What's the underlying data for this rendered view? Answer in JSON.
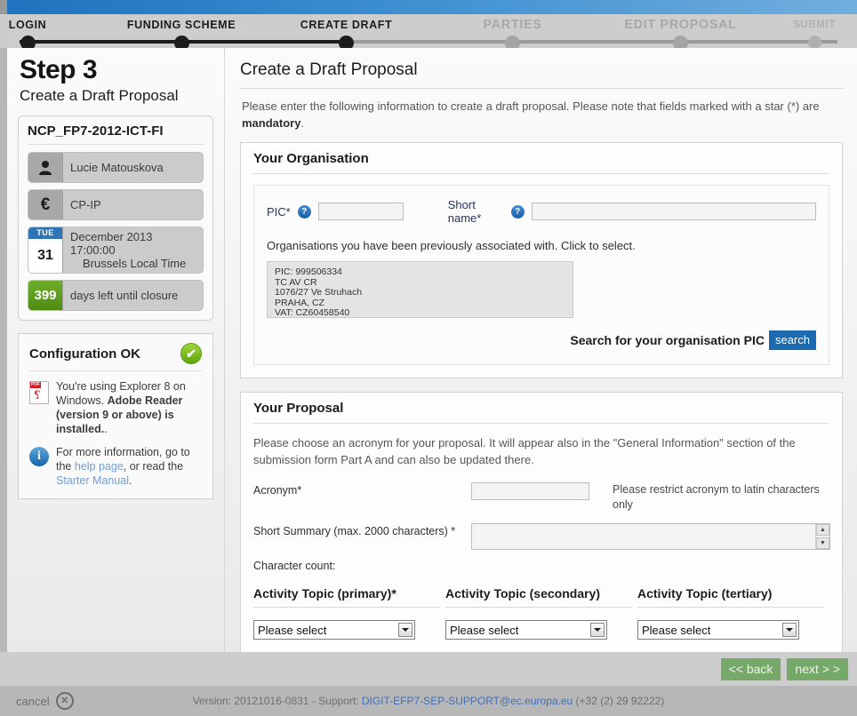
{
  "stepper": {
    "steps": [
      {
        "label": "LOGIN",
        "state": "done"
      },
      {
        "label": "FUNDING SCHEME",
        "state": "done"
      },
      {
        "label": "CREATE DRAFT",
        "state": "done"
      },
      {
        "label": "PARTIES",
        "state": "todo"
      },
      {
        "label": "EDIT PROPOSAL",
        "state": "todo"
      },
      {
        "label": "SUBMIT",
        "state": "last"
      }
    ]
  },
  "sidebar": {
    "step_title": "Step 3",
    "step_subtitle": "Create a Draft Proposal",
    "call_card": {
      "title": "NCP_FP7-2012-ICT-FI",
      "user_name": "Lucie Matouskova",
      "user_icon": "person-icon",
      "scheme": "CP-IP",
      "scheme_icon": "euro-icon",
      "deadline_weekday": "TUE",
      "deadline_day": "31",
      "deadline_line1": "December 2013 17:00:00",
      "deadline_line2": "Brussels Local Time",
      "days_left": "399",
      "days_left_label": "days left until closure"
    },
    "config_card": {
      "title": "Configuration OK",
      "status_icon": "check-circle-icon",
      "status_check": "✔",
      "pdf_icon": "pdf-icon",
      "browser_text_1": "You're using Explorer 8 on Windows. ",
      "browser_text_bold": "Adobe Reader (version 9 or above) is installed.",
      "browser_text_2": ".",
      "info_icon": "info-icon",
      "info_text_1": "For more information, go to the ",
      "info_link_1": "help page",
      "info_text_2": ", or read the ",
      "info_link_2": "Starter Manual",
      "info_text_3": "."
    }
  },
  "main": {
    "title": "Create a Draft Proposal",
    "intro_1": "Please enter the following information to create a draft proposal. Please note that fields marked with a star (*) are ",
    "intro_bold": "mandatory",
    "intro_2": ".",
    "organisation": {
      "heading": "Your Organisation",
      "pic_label": "PIC*",
      "pic_help": "?",
      "pic_value": "",
      "shortname_label": "Short name*",
      "shortname_help": "?",
      "shortname_value": "",
      "assoc_label": "Organisations you have been previously associated with. Click to select.",
      "assoc_entry": "PIC: 999506334\nTC AV CR\n1076/27 Ve Struhach\nPRAHA, CZ\nVAT: CZ60458540",
      "search_label": "Search for your organisation PIC",
      "search_button": "search"
    },
    "proposal": {
      "heading": "Your Proposal",
      "description": "Please choose an acronym for your proposal. It will appear also in the \"General Information\" section of the submission form Part A and can also be updated there.",
      "acronym_label": "Acronym*",
      "acronym_value": "",
      "acronym_hint": "Please restrict acronym to latin characters only",
      "summary_label": "Short Summary (max. 2000 characters) *",
      "summary_value": "",
      "char_count_label": "Character count:",
      "scroll_up_icon": "▲",
      "scroll_down_icon": "▼",
      "topics": [
        {
          "title": "Activity Topic (primary)*",
          "selected": "Please select"
        },
        {
          "title": "Activity Topic (secondary)",
          "selected": "Please select"
        },
        {
          "title": "Activity Topic (tertiary)",
          "selected": "Please select"
        }
      ]
    }
  },
  "actions": {
    "back_label": "<< back",
    "next_label": "next > >"
  },
  "footer": {
    "cancel_label": "cancel",
    "cancel_icon": "✕",
    "version_text": "Version: 20121016-0831 - Support: ",
    "support_email": "DIGIT-EFP7-SEP-SUPPORT@ec.europa.eu",
    "support_phone": " (+32 (2) 29 92222)"
  },
  "colors": {
    "brand_blue": "#1f72bd",
    "accent_green": "#4e8c11",
    "button_green": "#76a86a",
    "link_blue": "#3f6fbd"
  }
}
